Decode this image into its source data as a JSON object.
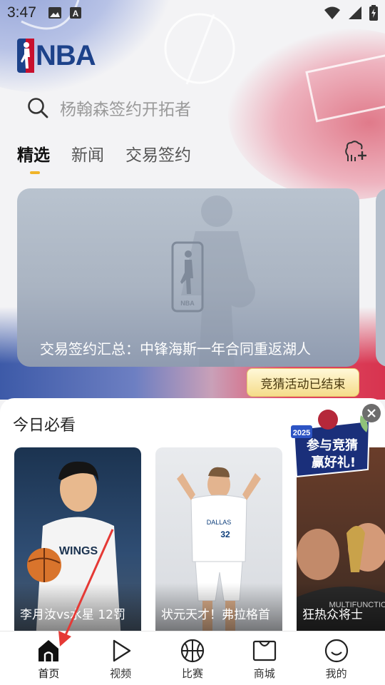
{
  "status_bar": {
    "time": "3:47",
    "icons_left": [
      "image-icon",
      "text-a-icon"
    ],
    "icons_right": [
      "wifi-icon",
      "signal-icon",
      "battery-icon"
    ]
  },
  "header": {
    "logo_text": "NBA",
    "search_placeholder": "杨翰森签约开拓者"
  },
  "tabs": [
    {
      "label": "精选",
      "active": true
    },
    {
      "label": "新闻",
      "active": false
    },
    {
      "label": "交易签约",
      "active": false
    }
  ],
  "hero": {
    "caption": "交易签约汇总：中锋海斯一年合同重返湖人",
    "badge": "竞猜活动已结束"
  },
  "must_see": {
    "title": "今日必看",
    "cards": [
      {
        "caption": "李月汝vs水星 12罚",
        "accent": "#1e3a5f"
      },
      {
        "caption": "状元天才！弗拉格首",
        "accent": "#c8ccd2"
      },
      {
        "caption": "狂热众将士"
      }
    ]
  },
  "promo": {
    "line1": "参与竞猜",
    "line2": "赢好礼!",
    "tag": "2025"
  },
  "bottom_nav": [
    {
      "label": "首页",
      "icon": "home-icon",
      "active": true
    },
    {
      "label": "视频",
      "icon": "play-icon",
      "active": false
    },
    {
      "label": "比赛",
      "icon": "basketball-icon",
      "active": false
    },
    {
      "label": "商城",
      "icon": "shop-icon",
      "active": false
    },
    {
      "label": "我的",
      "icon": "profile-icon",
      "active": false
    }
  ],
  "colors": {
    "brand_blue": "#1d428a",
    "brand_red": "#c8102e",
    "tab_indicator": "#f0b429",
    "annotation_red": "#e53935"
  }
}
